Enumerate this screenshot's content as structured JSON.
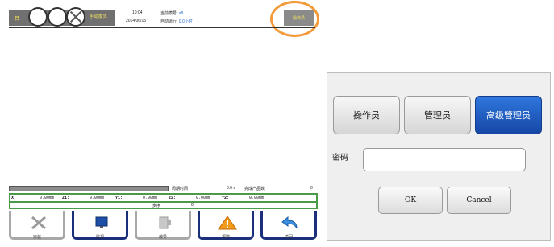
{
  "header": {
    "mode_indicator": "目",
    "mode_label": "手动模式",
    "time": "10:04",
    "date": "2014/06/15",
    "program_label": "当前模号:",
    "program_value": "a8",
    "run_label": "自动运行:",
    "run_value": "0.0小时",
    "operator_button": "操作员",
    "highlight_color": "#f39a3a"
  },
  "info": {
    "cycle_label": "周期时间",
    "cycle_value": "0.0 s",
    "product_label": "完成产品数",
    "product_value": "0"
  },
  "coords": {
    "items": [
      {
        "label": "X:",
        "value": "0.00mm"
      },
      {
        "label": "Z1:",
        "value": "0.00mm"
      },
      {
        "label": "Y1:",
        "value": "0.00mm"
      },
      {
        "label": "Z2:",
        "value": "0.00mm"
      },
      {
        "label": "Y2:",
        "value": "0.00mm"
      }
    ],
    "step_label": "步序",
    "step_value": "0"
  },
  "nav": [
    {
      "label": "安装",
      "icon": "tools-icon",
      "enabled": false
    },
    {
      "label": "监视",
      "icon": "monitor-icon",
      "enabled": true
    },
    {
      "label": "教导",
      "icon": "teach-icon",
      "enabled": false
    },
    {
      "label": "报警",
      "icon": "warning-icon",
      "enabled": true
    },
    {
      "label": "返回",
      "icon": "return-icon",
      "enabled": true
    }
  ],
  "dialog": {
    "roles": [
      "操作员",
      "管理员",
      "高级管理员"
    ],
    "selected_role": "高级管理员",
    "password_label": "密码",
    "password_value": "",
    "ok": "OK",
    "cancel": "Cancel",
    "accent_color": "#1f5fc8"
  }
}
